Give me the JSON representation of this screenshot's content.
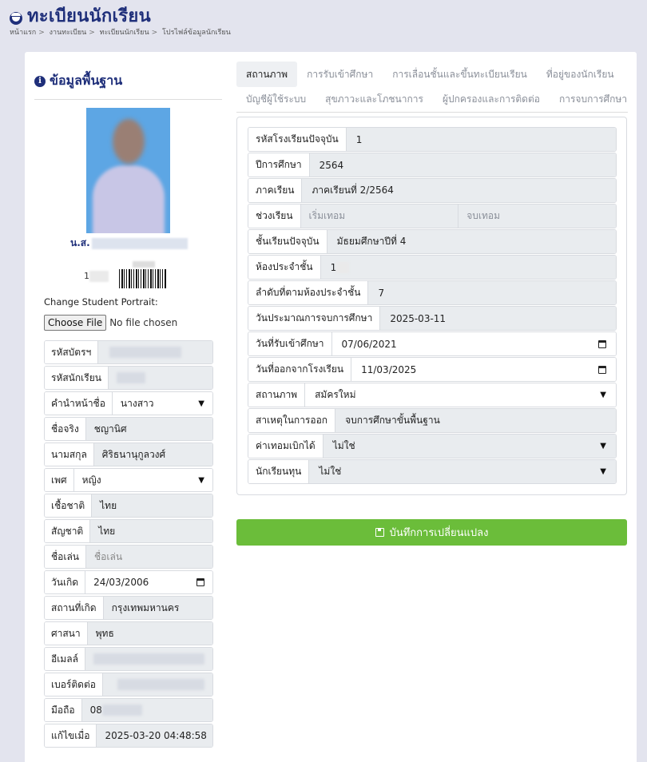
{
  "header": {
    "title": "ทะเบียนนักเรียน",
    "breadcrumb": [
      "หน้าแรก",
      "งานทะเบียน",
      "ทะเบียนนักเรียน",
      "โปรไฟล์ข้อมูลนักเรียน"
    ]
  },
  "profile": {
    "section_title": "ข้อมูลพื้นฐาน",
    "name_prefix": "น.ส.",
    "student_no_prefix": "1",
    "change_portrait_label": "Change Student Portrait:",
    "choose_file_label": "Choose File",
    "no_file_text": "No file chosen",
    "fields": [
      {
        "label": "รหัสบัตรฯ",
        "value": ""
      },
      {
        "label": "รหัสนักเรียน",
        "value": ""
      },
      {
        "label": "คำนำหน้าชื่อ",
        "value": "นางสาว"
      },
      {
        "label": "ชื่อจริง",
        "value": "ชญานิศ"
      },
      {
        "label": "นามสกุล",
        "value": "ศิริธนานุกูลวงศ์"
      },
      {
        "label": "เพศ",
        "value": "หญิง"
      },
      {
        "label": "เชื้อชาติ",
        "value": "ไทย"
      },
      {
        "label": "สัญชาติ",
        "value": "ไทย"
      },
      {
        "label": "ชื่อเล่น",
        "placeholder": "ชื่อเล่น"
      },
      {
        "label": "วันเกิด",
        "value": "24/03/2006"
      },
      {
        "label": "สถานที่เกิด",
        "value": "กรุงเทพมหานคร"
      },
      {
        "label": "ศาสนา",
        "value": "พุทธ"
      },
      {
        "label": "อีเมลล์",
        "value": ""
      },
      {
        "label": "เบอร์ติดต่อ",
        "value": ""
      },
      {
        "label": "มือถือ",
        "value": "08"
      },
      {
        "label": "แก้ไขเมื่อ",
        "value": "2025-03-20 04:48:58"
      }
    ]
  },
  "tabs": {
    "row1": [
      "สถานภาพ",
      "การรับเข้าศึกษา",
      "การเลื่อนชั้นและขึ้นทะเบียนเรียน",
      "ที่อยู่ของนักเรียน"
    ],
    "row2": [
      "บัญชีผู้ใช้ระบบ",
      "สุขภาวะและโภชนาการ",
      "ผู้ปกครองและการติดต่อ",
      "การจบการศึกษา"
    ],
    "active": "สถานภาพ"
  },
  "status": {
    "fields": [
      {
        "label": "รหัสโรงเรียนปัจจุบัน",
        "value": "1"
      },
      {
        "label": "ปีการศึกษา",
        "value": "2564"
      },
      {
        "label": "ภาคเรียน",
        "value": "ภาคเรียนที่ 2/2564"
      },
      {
        "label": "ช่วงเรียน",
        "placeholder_start": "เริ่มเทอม",
        "placeholder_end": "จบเทอม"
      },
      {
        "label": "ชั้นเรียนปัจจุบัน",
        "value": "มัธยมศึกษาปีที่ 4"
      },
      {
        "label": "ห้องประจำชั้น",
        "value": "1"
      },
      {
        "label": "ลำดับที่ตามห้องประจำชั้น",
        "value": "7"
      },
      {
        "label": "วันประมาณการจบการศึกษา",
        "value": "2025-03-11"
      },
      {
        "label": "วันที่รับเข้าศึกษา",
        "value": "07/06/2021"
      },
      {
        "label": "วันที่ออกจากโรงเรียน",
        "value": "11/03/2025"
      },
      {
        "label": "สถานภาพ",
        "value": "สมัครใหม่"
      },
      {
        "label": "สาเหตุในการออก",
        "value": "จบการศึกษาขั้นพื้นฐาน"
      },
      {
        "label": "ค่าเทอมเบิกได้",
        "value": "ไม่ใช่"
      },
      {
        "label": "นักเรียนทุน",
        "value": "ไม่ใช่"
      }
    ],
    "save_label": "บันทึกการเปลี่ยนแปลง"
  },
  "colors": {
    "primary": "#1f2f7a",
    "save": "#6bbd3a",
    "background": "#e3e4ee"
  }
}
